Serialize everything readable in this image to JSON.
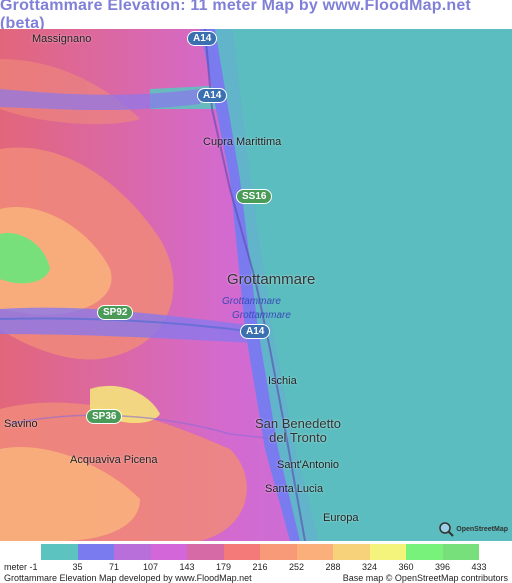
{
  "title": "Grottammare Elevation: 11 meter Map by www.FloodMap.net (beta)",
  "map": {
    "places": {
      "massignano": "Massignano",
      "cupra": "Cupra Marittima",
      "grottammare": "Grottammare",
      "grottammare_small1": "Grottammare",
      "grottammare_small2": "Grottammare",
      "ischia": "Ischia",
      "sbt_line1": "San Benedetto",
      "sbt_line2": "del Tronto",
      "santantonio": "Sant'Antonio",
      "santalucia": "Santa Lucia",
      "europa": "Europa",
      "savino": "Savino",
      "acquaviva": "Acquaviva Picena"
    },
    "roads": {
      "a14_top": "A14",
      "a14_mid": "A14",
      "a14_low": "A14",
      "ss16": "SS16",
      "sp92": "SP92",
      "sp36": "SP36"
    },
    "osm_logo_text": "OpenStreetMap"
  },
  "legend": {
    "unit_label": "meter",
    "ticks": [
      "-1",
      "35",
      "71",
      "107",
      "143",
      "179",
      "216",
      "252",
      "288",
      "324",
      "360",
      "396",
      "433"
    ],
    "colors": [
      "#5cc3c0",
      "#7b7bf0",
      "#b86fd9",
      "#d366d8",
      "#d66aa6",
      "#f47a7a",
      "#f89a78",
      "#fbb07c",
      "#f8d27a",
      "#f4f37c",
      "#78f27a",
      "#78e07a"
    ]
  },
  "footer": {
    "left": "Grottammare Elevation Map developed by www.FloodMap.net",
    "right": "Base map © OpenStreetMap contributors"
  },
  "colors": {
    "sea": "#5bbdbf",
    "title": "#8080d8"
  }
}
